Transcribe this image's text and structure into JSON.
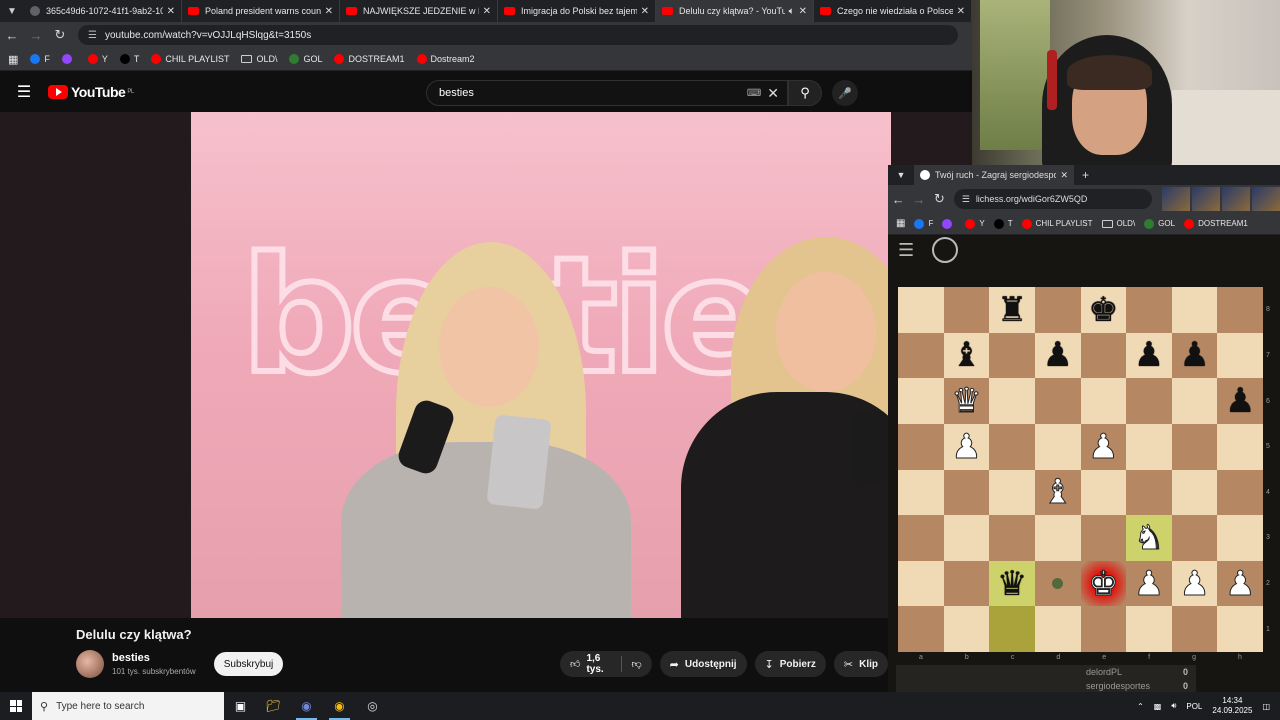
{
  "browser": {
    "tabs": [
      {
        "title": "365c49d6-1072-41f1-9ab2-10e",
        "active": false,
        "favicon": "github-icon"
      },
      {
        "title": "Poland president warns country",
        "active": false,
        "favicon": "youtube-icon"
      },
      {
        "title": "NAJWIĘKSZE JEDZENIE w POLS",
        "active": false,
        "favicon": "youtube-icon"
      },
      {
        "title": "Imigracja do Polski bez tajemnic",
        "active": false,
        "favicon": "youtube-icon"
      },
      {
        "title": "Delulu czy klątwa? - YouTube",
        "active": true,
        "favicon": "youtube-icon"
      },
      {
        "title": "Czego nie wiedziała o Polsce? I",
        "active": false,
        "favicon": "youtube-icon"
      }
    ],
    "url": "youtube.com/watch?v=vOJJLqHSlqg&t=3150s",
    "bookmarks": [
      {
        "label": "F",
        "color": "#1877f2"
      },
      {
        "label": "",
        "color": "#9146ff"
      },
      {
        "label": "Y",
        "color": "#ff0000"
      },
      {
        "label": "T",
        "color": "#000000"
      },
      {
        "label": "CHIL PLAYLIST",
        "color": "#ff0000"
      },
      {
        "label": "OLD\\",
        "color": "folder"
      },
      {
        "label": "GOL",
        "color": "#2e7d32"
      },
      {
        "label": "DOSTREAM1",
        "color": "#ff0000"
      },
      {
        "label": "Dostream2",
        "color": "#ff0000"
      }
    ]
  },
  "youtube": {
    "logo_text": "YouTube",
    "region": "PL",
    "search_value": "besties",
    "video": {
      "neon_text": "bestie",
      "title": "Delulu czy klątwa?",
      "channel": "besties",
      "subscribers": "101 tys. subskrybentów",
      "subscribe_label": "Subskrybuj",
      "likes": "1,6 tys.",
      "share_label": "Udostępnij",
      "download_label": "Pobierz",
      "clip_label": "Klip"
    }
  },
  "lichess": {
    "tab_title": "Twój ruch - Zagraj sergiodespo",
    "url": "lichess.org/wdiGor6ZW5QD",
    "bookmarks": [
      {
        "label": "F"
      },
      {
        "label": ""
      },
      {
        "label": "Y"
      },
      {
        "label": "T"
      },
      {
        "label": "CHIL PLAYLIST"
      },
      {
        "label": "OLD\\"
      },
      {
        "label": "GOL"
      },
      {
        "label": "DOSTREAM1"
      }
    ],
    "board": [
      [
        "",
        "",
        "b-rook",
        "",
        "b-king",
        "",
        "",
        ""
      ],
      [
        "",
        "b-bishop",
        "",
        "b-pawn",
        "",
        "b-pawn",
        "b-pawn",
        ""
      ],
      [
        "",
        "w-queen",
        "",
        "",
        "",
        "",
        "",
        "b-pawn"
      ],
      [
        "",
        "w-pawn",
        "",
        "",
        "w-pawn",
        "",
        "",
        ""
      ],
      [
        "",
        "",
        "",
        "w-bishop",
        "",
        "",
        "",
        ""
      ],
      [
        "",
        "",
        "",
        "",
        "",
        "w-knight",
        "",
        ""
      ],
      [
        "",
        "",
        "b-queen",
        "",
        "w-king",
        "w-pawn",
        "w-pawn",
        "w-pawn"
      ],
      [
        "",
        "",
        "",
        "",
        "",
        "",
        "",
        ""
      ]
    ],
    "highlighted_squares": [
      "c2",
      "c1",
      "f3"
    ],
    "check_square": "e2",
    "move_dot_square": "d2",
    "files": [
      "a",
      "b",
      "c",
      "d",
      "e",
      "f",
      "g",
      "h"
    ],
    "ranks": [
      "8",
      "7",
      "6",
      "5",
      "4",
      "3",
      "2",
      "1"
    ],
    "players": [
      {
        "name": "delordPL",
        "score": "0"
      },
      {
        "name": "sergiodesportes",
        "score": "0"
      }
    ]
  },
  "taskbar": {
    "search_placeholder": "Type here to search",
    "language": "POL",
    "time": "14:34",
    "date": "24.09.2025"
  },
  "colors": {
    "accent": "#ff0000",
    "board_light": "#f0d9b5",
    "board_dark": "#b58863"
  }
}
